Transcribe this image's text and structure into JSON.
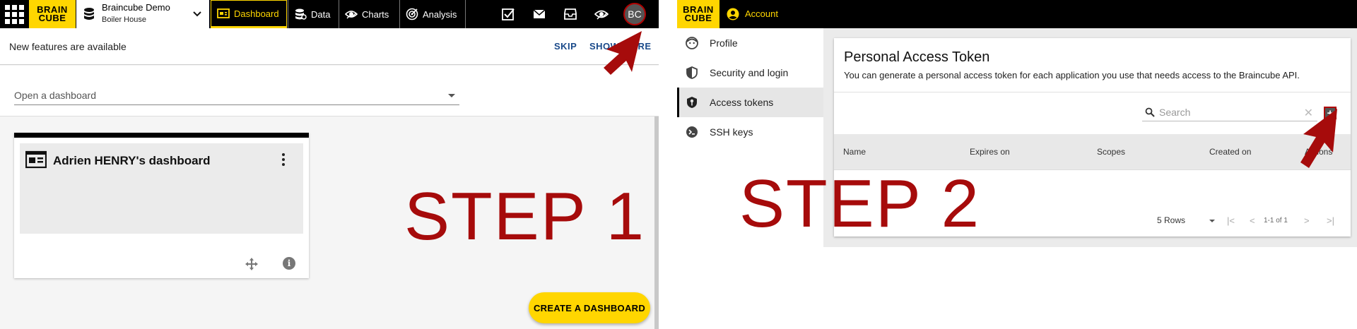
{
  "left_panel": {
    "brand": {
      "line1": "BRAIN",
      "line2": "CUBE"
    },
    "workspace": {
      "name": "Braincube Demo",
      "subtitle": "Boiler House"
    },
    "nav_tabs": [
      {
        "label": "Dashboard",
        "icon": "dashboard-icon",
        "active": true
      },
      {
        "label": "Data",
        "icon": "data-icon",
        "active": false
      },
      {
        "label": "Charts",
        "icon": "charts-icon",
        "active": false
      },
      {
        "label": "Analysis",
        "icon": "analysis-icon",
        "active": false
      }
    ],
    "avatar_initials": "BC",
    "banner": {
      "text": "New features are available",
      "skip": "SKIP",
      "show_more": "SHOW MORE"
    },
    "dashboard_selector": {
      "placeholder": "Open a dashboard"
    },
    "dashboard_card": {
      "title": "Adrien HENRY's dashboard"
    },
    "step_label": "STEP 1",
    "fab_label": "CREATE A DASHBOARD"
  },
  "right_panel": {
    "brand": {
      "line1": "BRAIN",
      "line2": "CUBE"
    },
    "account_label": "Account",
    "sidebar": [
      {
        "label": "Profile",
        "icon": "face-icon",
        "active": false
      },
      {
        "label": "Security and login",
        "icon": "shield-icon",
        "active": false
      },
      {
        "label": "Access tokens",
        "icon": "key-shield-icon",
        "active": true
      },
      {
        "label": "SSH keys",
        "icon": "terminal-key-icon",
        "active": false
      }
    ],
    "token_card": {
      "title": "Personal Access Token",
      "description": "You can generate a personal access token for each application you use that needs access to the Braincube API.",
      "search_placeholder": "Search",
      "columns": [
        "Name",
        "Expires on",
        "Scopes",
        "Created on",
        "Actions"
      ],
      "pager": {
        "rows_label": "5 Rows",
        "range": "1-1 of 1"
      }
    },
    "step_label": "STEP 2"
  },
  "colors": {
    "brand_yellow": "#ffd600",
    "step_red": "#a60b0b",
    "topbar": "#000000"
  }
}
